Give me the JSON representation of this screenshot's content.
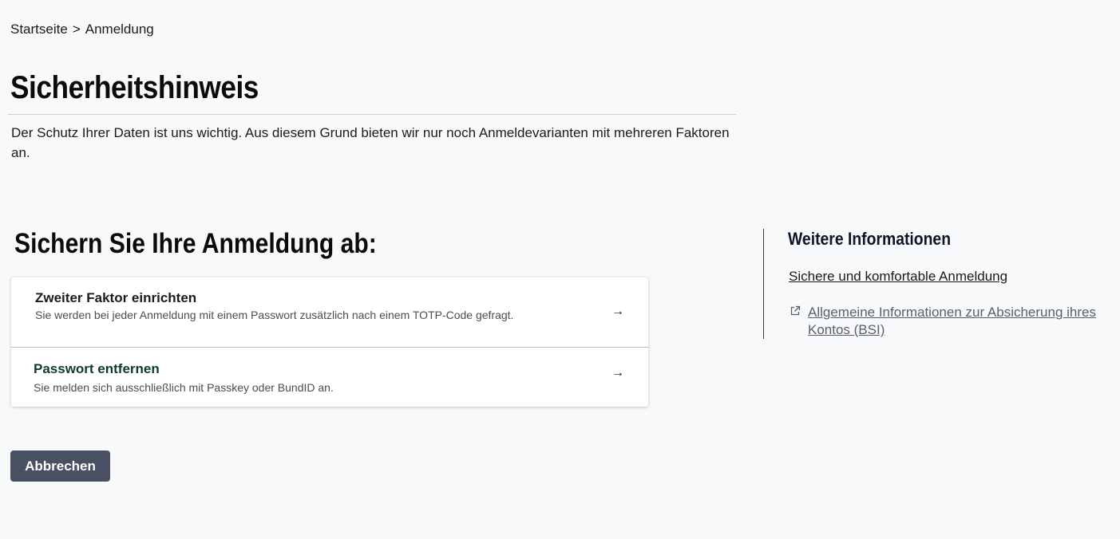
{
  "breadcrumb": {
    "home": "Startseite",
    "separator": ">",
    "current": "Anmeldung"
  },
  "page": {
    "title": "Sicherheitshinweis",
    "intro": "Der Schutz Ihrer Daten ist uns wichtig. Aus diesem Grund bieten wir nur noch Anmeldevarianten mit mehreren Faktoren an."
  },
  "section": {
    "title": "Sichern Sie Ihre Anmeldung ab:"
  },
  "options": [
    {
      "title": "Zweiter Faktor einrichten",
      "description": "Sie werden bei jeder Anmeldung mit einem Passwort zusätzlich nach einem TOTP-Code gefragt.",
      "icon": "arrow-right-icon",
      "arrow": "→"
    },
    {
      "title": "Passwort entfernen",
      "description": "Sie melden sich ausschließlich mit Passkey oder BundID an.",
      "icon": "arrow-right-icon",
      "arrow": "→"
    }
  ],
  "actions": {
    "cancel_label": "Abbrechen"
  },
  "sidebar": {
    "title": "Weitere Informationen",
    "links": [
      {
        "label": "Sichere und komfortable Anmeldung"
      },
      {
        "label": "Allgemeine Informationen zur Absicherung ihres Kontos (BSI)",
        "icon": "external-link-icon"
      }
    ]
  },
  "colors": {
    "background": "#f8f9fb",
    "button": "#4a5064",
    "text": "#1b1b1b",
    "muted_link": "#5a5f69"
  }
}
